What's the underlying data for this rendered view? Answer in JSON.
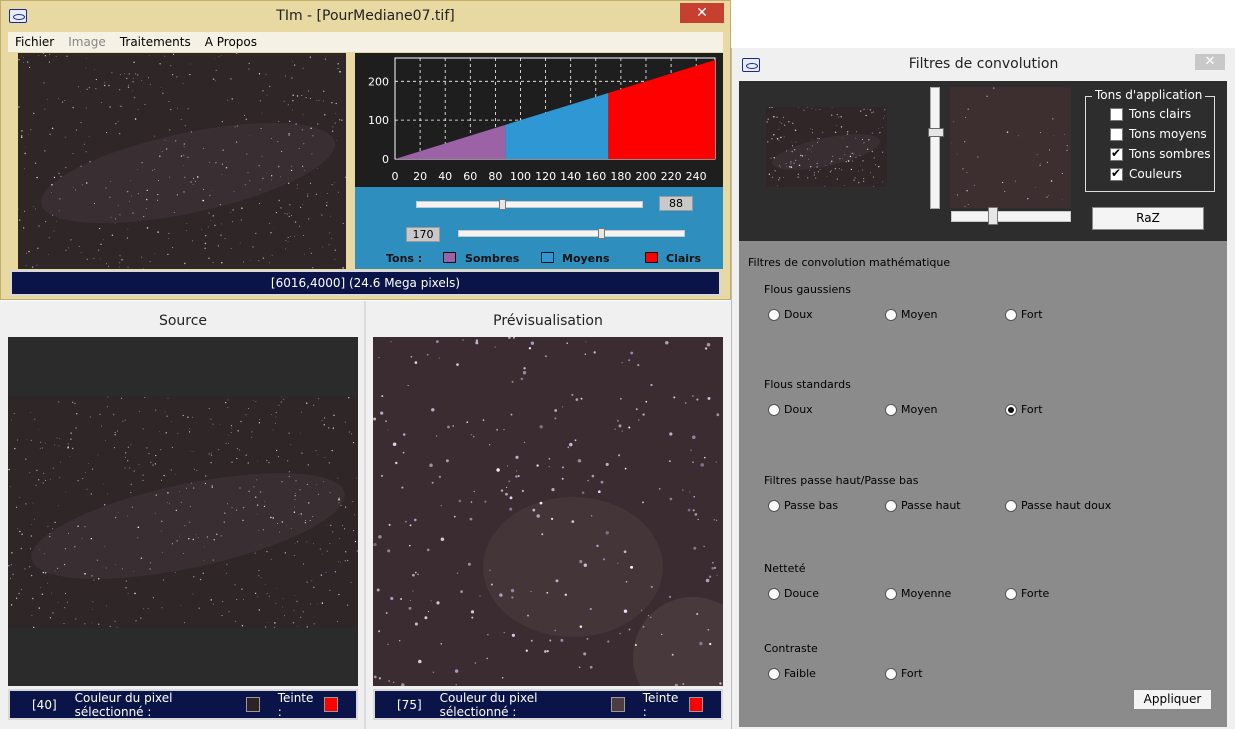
{
  "main": {
    "title": "TIm - [PourMediane07.tif]",
    "close_label": "✕",
    "menu": [
      "Fichier",
      "Image",
      "Traitements",
      "A Propos"
    ],
    "info": "[6016,4000] (24.6 Mega pixels)"
  },
  "tones": {
    "slider_dark_value": "88",
    "slider_light_value": "170",
    "tons_label": "Tons :",
    "sombres": "Sombres",
    "moyens": "Moyens",
    "clairs": "Clairs",
    "colors": {
      "sombres": "#9b62a6",
      "moyens": "#2f98d4",
      "clairs": "#ff0000"
    }
  },
  "chart_data": {
    "type": "area",
    "x": [
      0,
      255
    ],
    "y": [
      0,
      255
    ],
    "segments": [
      {
        "from": 0,
        "to": 88,
        "color": "#9b62a6"
      },
      {
        "from": 88,
        "to": 170,
        "color": "#2f98d4"
      },
      {
        "from": 170,
        "to": 255,
        "color": "#ff0000"
      }
    ],
    "xticks": [
      0,
      20,
      40,
      60,
      80,
      100,
      120,
      140,
      160,
      180,
      200,
      220,
      240
    ],
    "yticks": [
      0,
      100,
      200
    ],
    "xlim": [
      0,
      255
    ],
    "ylim": [
      0,
      260
    ],
    "grid": true
  },
  "source": {
    "title": "Source",
    "pixel_index": "[40]",
    "pixel_color_label": "Couleur du pixel sélectionné :",
    "pixel_color": "#2b2224",
    "hue_label": "Teinte :",
    "hue_color": "#ff0000"
  },
  "preview": {
    "title": "Prévisualisation",
    "pixel_index": "[75]",
    "pixel_color_label": "Couleur du pixel sélectionné :",
    "pixel_color": "#4d3c40",
    "hue_label": "Teinte :",
    "hue_color": "#ff0000"
  },
  "conv": {
    "title": "Filtres de convolution",
    "close_label": "✕",
    "tons_title": "Tons d'application",
    "checkboxes": [
      {
        "label": "Tons clairs",
        "checked": false
      },
      {
        "label": "Tons moyens",
        "checked": false
      },
      {
        "label": "Tons sombres",
        "checked": true
      },
      {
        "label": "Couleurs",
        "checked": true
      }
    ],
    "raz": "RaZ",
    "heading": "Filtres de convolution mathématique",
    "sections": [
      {
        "label": "Flous gaussiens",
        "options": [
          "Doux",
          "Moyen",
          "Fort"
        ],
        "selected": -1
      },
      {
        "label": "Flous standards",
        "options": [
          "Doux",
          "Moyen",
          "Fort"
        ],
        "selected": 2
      },
      {
        "label": "Filtres passe haut/Passe bas",
        "options": [
          "Passe bas",
          "Passe haut",
          "Passe haut doux"
        ],
        "selected": -1
      },
      {
        "label": "Netteté",
        "options": [
          "Douce",
          "Moyenne",
          "Forte"
        ],
        "selected": -1
      },
      {
        "label": "Contraste",
        "options": [
          "Faible",
          "Fort"
        ],
        "selected": -1
      }
    ],
    "apply": "Appliquer"
  }
}
